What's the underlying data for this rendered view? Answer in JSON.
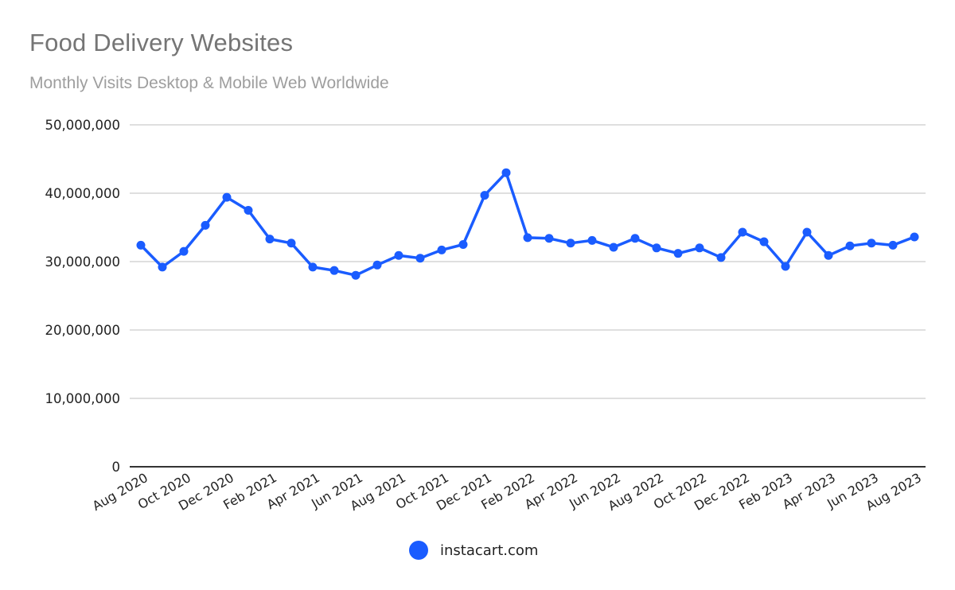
{
  "chart_data": {
    "type": "line",
    "title": "Food Delivery Websites",
    "subtitle": "Monthly Visits Desktop & Mobile Web Worldwide",
    "xlabel": "",
    "ylabel": "",
    "ylim": [
      0,
      50000000
    ],
    "y_ticks": [
      0,
      10000000,
      20000000,
      30000000,
      40000000,
      50000000
    ],
    "y_tick_labels": [
      "0",
      "10,000,000",
      "20,000,000",
      "30,000,000",
      "40,000,000",
      "50,000,000"
    ],
    "grid": true,
    "legend_position": "bottom",
    "x": [
      "Aug 2020",
      "Sep 2020",
      "Oct 2020",
      "Nov 2020",
      "Dec 2020",
      "Jan 2021",
      "Feb 2021",
      "Mar 2021",
      "Apr 2021",
      "May 2021",
      "Jun 2021",
      "Jul 2021",
      "Aug 2021",
      "Sep 2021",
      "Oct 2021",
      "Nov 2021",
      "Dec 2021",
      "Jan 2022",
      "Feb 2022",
      "Mar 2022",
      "Apr 2022",
      "May 2022",
      "Jun 2022",
      "Jul 2022",
      "Aug 2022",
      "Sep 2022",
      "Oct 2022",
      "Nov 2022",
      "Dec 2022",
      "Jan 2023",
      "Feb 2023",
      "Mar 2023",
      "Apr 2023",
      "May 2023",
      "Jun 2023",
      "Jul 2023",
      "Aug 2023"
    ],
    "x_tick_labels": [
      "Aug 2020",
      "Oct 2020",
      "Dec 2020",
      "Feb 2021",
      "Apr 2021",
      "Jun 2021",
      "Aug 2021",
      "Oct 2021",
      "Dec 2021",
      "Feb 2022",
      "Apr 2022",
      "Jun 2022",
      "Aug 2022",
      "Oct 2022",
      "Dec 2022",
      "Feb 2023",
      "Apr 2023",
      "Jun 2023",
      "Aug 2023"
    ],
    "series": [
      {
        "name": "instacart.com",
        "color": "#1a5cff",
        "values": [
          32400000,
          29200000,
          31500000,
          35300000,
          39400000,
          37500000,
          33300000,
          32700000,
          29200000,
          28700000,
          28000000,
          29500000,
          30900000,
          30500000,
          31700000,
          32500000,
          39700000,
          43000000,
          33500000,
          33400000,
          32700000,
          33100000,
          32100000,
          33400000,
          32000000,
          31200000,
          32000000,
          30600000,
          34300000,
          32900000,
          29300000,
          34300000,
          30900000,
          32300000,
          32700000,
          32400000,
          33600000
        ]
      }
    ]
  }
}
